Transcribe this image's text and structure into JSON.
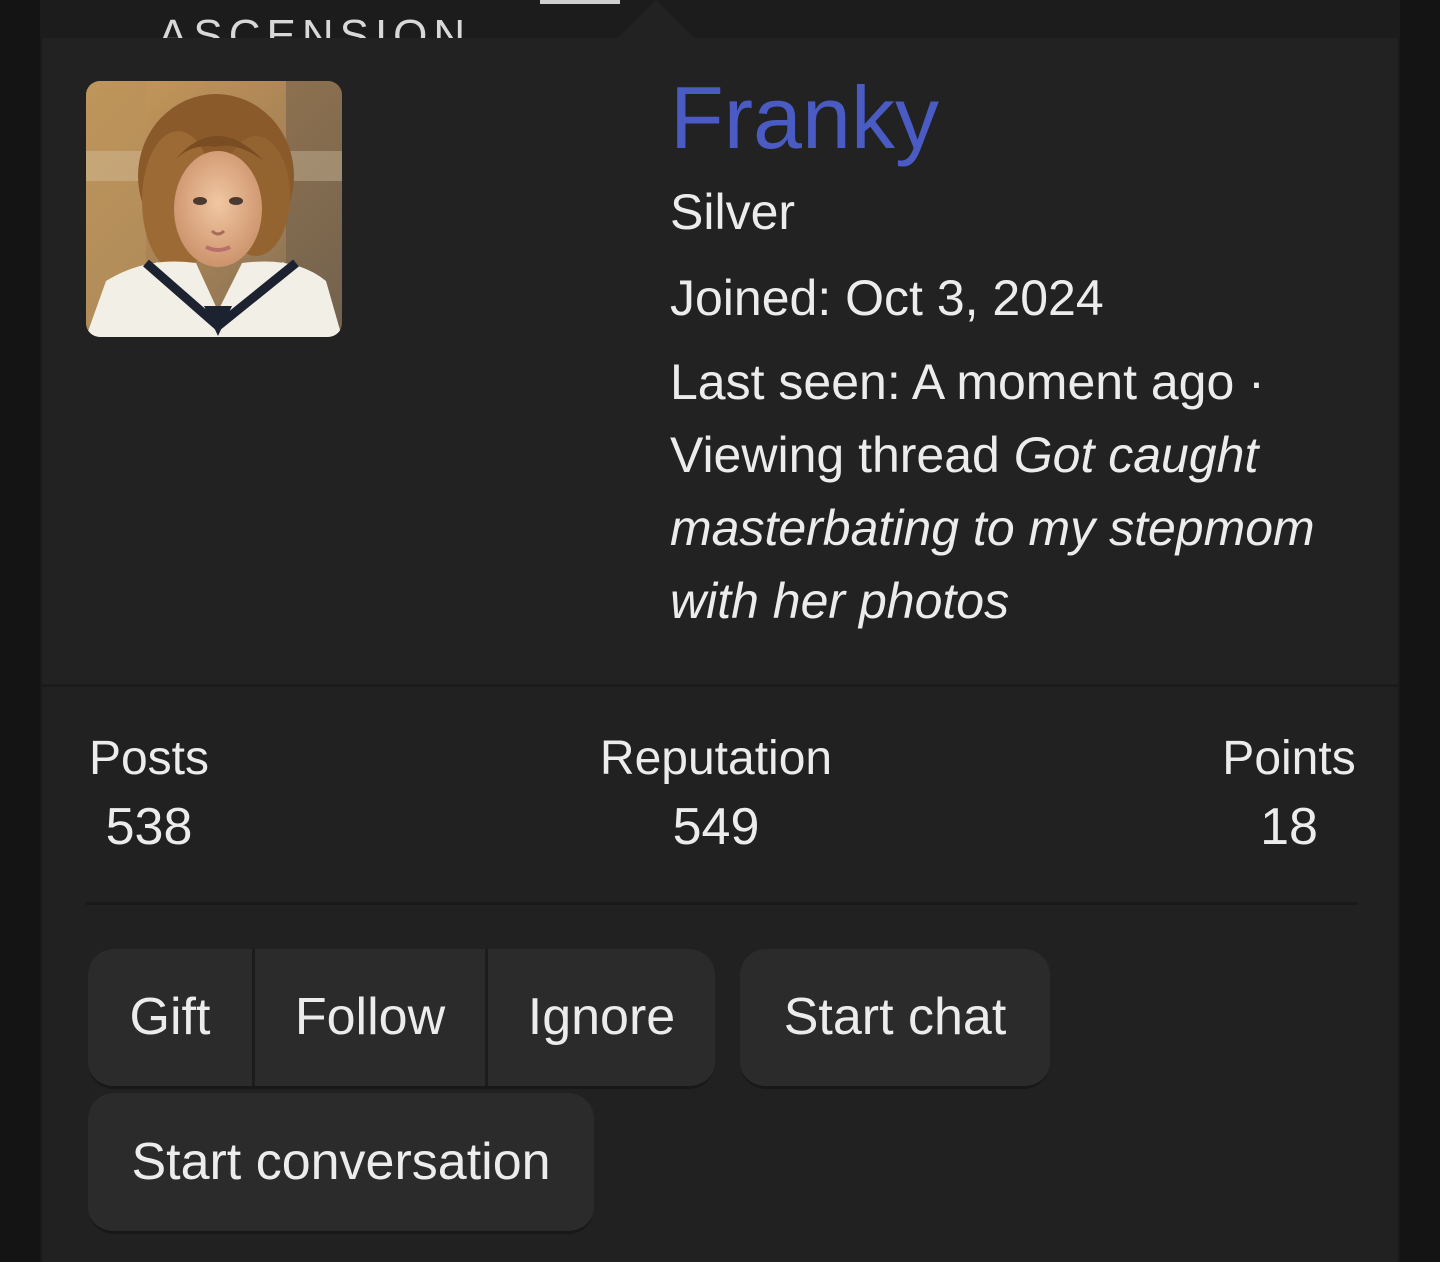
{
  "header": {
    "site_title": "ASCENSION"
  },
  "profile": {
    "username": "Franky",
    "rank": "Silver",
    "joined_label": "Joined:",
    "joined_value": "Oct 3, 2024",
    "last_seen_label": "Last seen:",
    "last_seen_value": "A moment ago ·",
    "activity_prefix": "Viewing thread",
    "activity_thread": "Got caught masterbating to my stepmom with her photos",
    "username_color": "#4a5bc4"
  },
  "stats": {
    "posts_label": "Posts",
    "posts_value": "538",
    "reputation_label": "Reputation",
    "reputation_value": "549",
    "points_label": "Points",
    "points_value": "18"
  },
  "actions": {
    "gift": "Gift",
    "follow": "Follow",
    "ignore": "Ignore",
    "start_chat": "Start chat",
    "start_conversation": "Start conversation"
  }
}
